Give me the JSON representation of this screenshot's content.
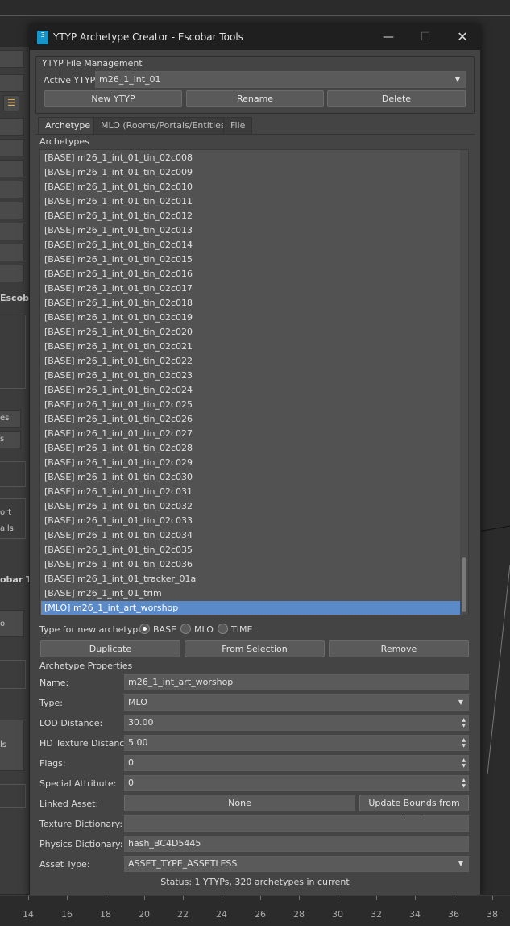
{
  "window": {
    "title": "YTYP Archetype Creator - Escobar Tools",
    "app_icon": "3ds-max-icon"
  },
  "background_panel": {
    "labels": [
      "Escob",
      "obar To",
      "es",
      "s",
      "ort",
      "ails",
      "ol",
      "ls"
    ]
  },
  "file_management": {
    "group_label": "YTYP File Management",
    "active_label": "Active YTYP:",
    "active_value": "m26_1_int_01",
    "buttons": [
      "New YTYP",
      "Rename",
      "Delete"
    ]
  },
  "tabs": [
    "Archetype",
    "MLO (Rooms/Portals/Entities)",
    "File"
  ],
  "archetypes": {
    "label": "Archetypes",
    "items": [
      "[BASE] m26_1_int_01_tin_02c008",
      "[BASE] m26_1_int_01_tin_02c009",
      "[BASE] m26_1_int_01_tin_02c010",
      "[BASE] m26_1_int_01_tin_02c011",
      "[BASE] m26_1_int_01_tin_02c012",
      "[BASE] m26_1_int_01_tin_02c013",
      "[BASE] m26_1_int_01_tin_02c014",
      "[BASE] m26_1_int_01_tin_02c015",
      "[BASE] m26_1_int_01_tin_02c016",
      "[BASE] m26_1_int_01_tin_02c017",
      "[BASE] m26_1_int_01_tin_02c018",
      "[BASE] m26_1_int_01_tin_02c019",
      "[BASE] m26_1_int_01_tin_02c020",
      "[BASE] m26_1_int_01_tin_02c021",
      "[BASE] m26_1_int_01_tin_02c022",
      "[BASE] m26_1_int_01_tin_02c023",
      "[BASE] m26_1_int_01_tin_02c024",
      "[BASE] m26_1_int_01_tin_02c025",
      "[BASE] m26_1_int_01_tin_02c026",
      "[BASE] m26_1_int_01_tin_02c027",
      "[BASE] m26_1_int_01_tin_02c028",
      "[BASE] m26_1_int_01_tin_02c029",
      "[BASE] m26_1_int_01_tin_02c030",
      "[BASE] m26_1_int_01_tin_02c031",
      "[BASE] m26_1_int_01_tin_02c032",
      "[BASE] m26_1_int_01_tin_02c033",
      "[BASE] m26_1_int_01_tin_02c034",
      "[BASE] m26_1_int_01_tin_02c035",
      "[BASE] m26_1_int_01_tin_02c036",
      "[BASE] m26_1_int_01_tracker_01a",
      "[BASE] m26_1_int_01_trim",
      "[MLO] m26_1_int_art_worshop"
    ],
    "selected": "[MLO] m26_1_int_art_worshop"
  },
  "new_type": {
    "label": "Type for new archetype:",
    "options": [
      "BASE",
      "MLO",
      "TIME"
    ],
    "selected": "BASE"
  },
  "list_buttons": [
    "Duplicate",
    "From Selection",
    "Remove"
  ],
  "properties": {
    "group_label": "Archetype Properties",
    "name_label": "Name:",
    "name_value": "m26_1_int_art_worshop",
    "type_label": "Type:",
    "type_value": "MLO",
    "lod_label": "LOD Distance:",
    "lod_value": "30.00",
    "hd_label": "HD Texture Distance:",
    "hd_value": "5.00",
    "flags_label": "Flags:",
    "flags_value": "0",
    "special_label": "Special Attribute:",
    "special_value": "0",
    "linked_label": "Linked Asset:",
    "linked_value": "None",
    "update_bounds": "Update Bounds from Asset",
    "texdict_label": "Texture Dictionary:",
    "texdict_value": "",
    "physdict_label": "Physics Dictionary:",
    "physdict_value": "hash_BC4D5445",
    "assettype_label": "Asset Type:",
    "assettype_value": "ASSET_TYPE_ASSETLESS"
  },
  "status": "Status: 1 YTYPs, 320 archetypes in current",
  "ruler": [
    "14",
    "16",
    "18",
    "20",
    "22",
    "24",
    "26",
    "28",
    "30",
    "32",
    "34",
    "36",
    "38"
  ],
  "colors": {
    "selection": "#5b8ac9",
    "window_bg": "#444444",
    "titlebar": "#1f1f1f"
  }
}
